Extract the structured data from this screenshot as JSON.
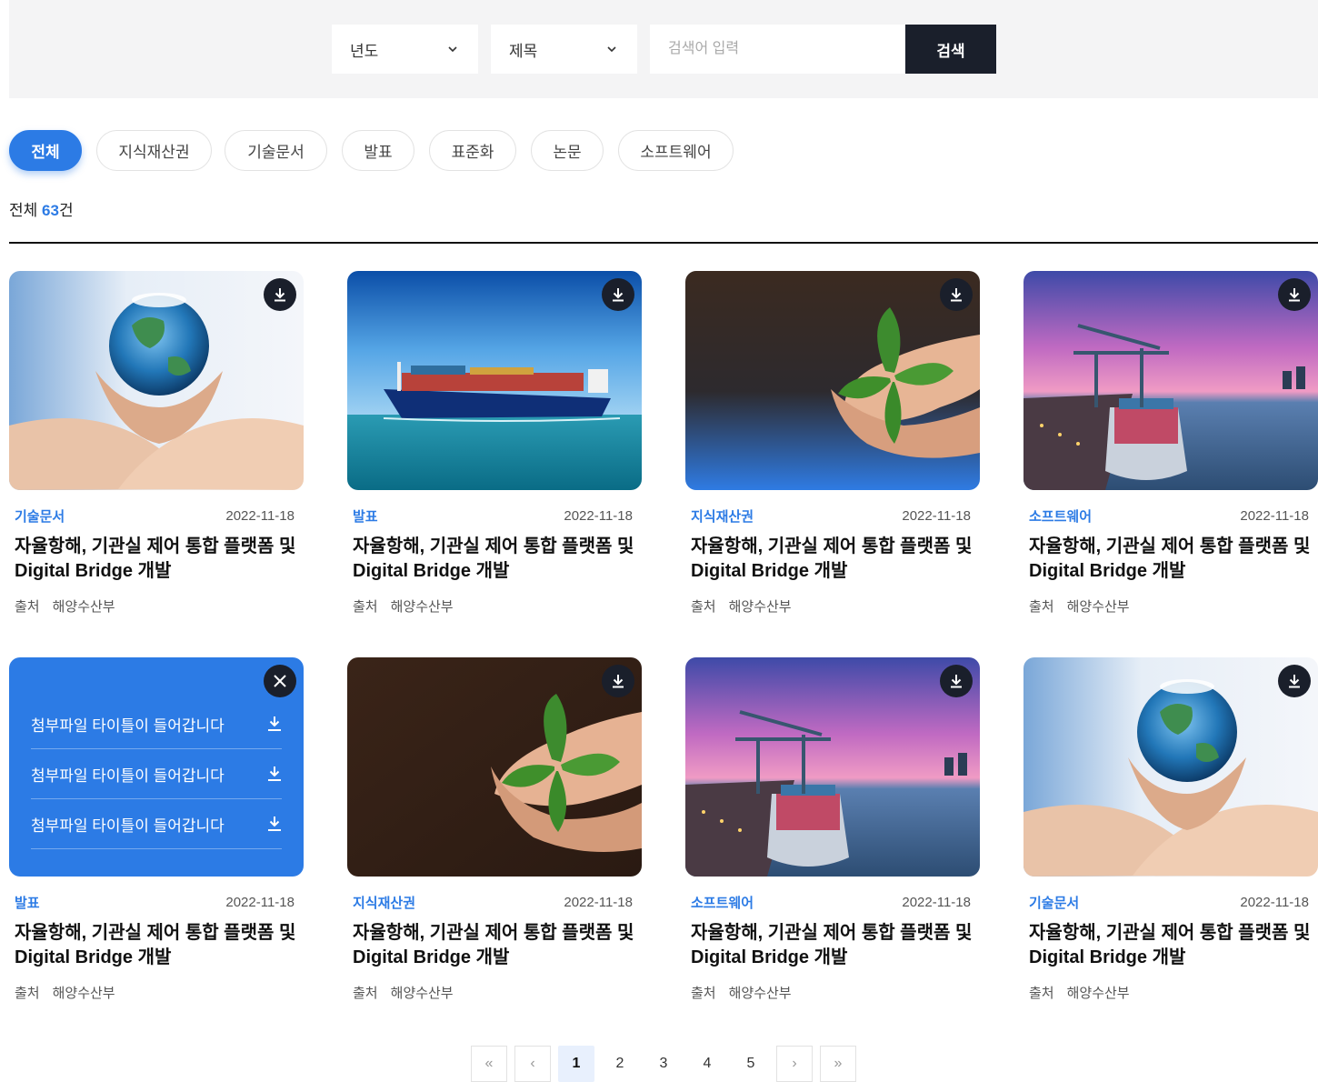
{
  "search": {
    "year_label": "년도",
    "field_label": "제목",
    "placeholder": "검색어 입력",
    "button_label": "검색"
  },
  "categories": [
    "전체",
    "지식재산권",
    "기술문서",
    "발표",
    "표준화",
    "논문",
    "소프트웨어"
  ],
  "active_category": "전체",
  "summary": {
    "prefix": "전체 ",
    "count": "63",
    "suffix": "건"
  },
  "source_label": "출처",
  "cards": [
    {
      "category": "기술문서",
      "date": "2022-11-18",
      "title": "자율항해, 기관실 제어 통합 플랫폼 및 Digital Bridge 개발",
      "source": "해양수산부",
      "image": "globe-in-hands"
    },
    {
      "category": "발표",
      "date": "2022-11-18",
      "title": "자율항해, 기관실 제어 통합 플랫폼 및 Digital Bridge 개발",
      "source": "해양수산부",
      "image": "container-ship"
    },
    {
      "category": "지식재산권",
      "date": "2022-11-18",
      "title": "자율항해, 기관실 제어 통합 플랫폼 및 Digital Bridge 개발",
      "source": "해양수산부",
      "image": "sprout-in-soil-blue"
    },
    {
      "category": "소프트웨어",
      "date": "2022-11-18",
      "title": "자율항해, 기관실 제어 통합 플랫폼 및 Digital Bridge 개발",
      "source": "해양수산부",
      "image": "port-cranes"
    },
    {
      "category": "발표",
      "date": "2022-11-18",
      "title": "자율항해, 기관실 제어 통합 플랫폼 및 Digital Bridge 개발",
      "source": "해양수산부",
      "image": "attachments-open",
      "attachments": [
        "첨부파일 타이틀이 들어갑니다",
        "첨부파일 타이틀이 들어갑니다",
        "첨부파일 타이틀이 들어갑니다"
      ]
    },
    {
      "category": "지식재산권",
      "date": "2022-11-18",
      "title": "자율항해, 기관실 제어 통합 플랫폼 및 Digital Bridge 개발",
      "source": "해양수산부",
      "image": "sprout-in-soil"
    },
    {
      "category": "소프트웨어",
      "date": "2022-11-18",
      "title": "자율항해, 기관실 제어 통합 플랫폼 및 Digital Bridge 개발",
      "source": "해양수산부",
      "image": "port-cranes"
    },
    {
      "category": "기술문서",
      "date": "2022-11-18",
      "title": "자율항해, 기관실 제어 통합 플랫폼 및 Digital Bridge 개발",
      "source": "해양수산부",
      "image": "globe-in-hands"
    }
  ],
  "pagination": {
    "pages": [
      "1",
      "2",
      "3",
      "4",
      "5"
    ],
    "current": "1",
    "first": "«",
    "prev": "‹",
    "next": "›",
    "last": "»"
  },
  "colors": {
    "accent": "#2c7be5",
    "dark": "#1a1f2b",
    "panel": "#f4f4f5"
  }
}
